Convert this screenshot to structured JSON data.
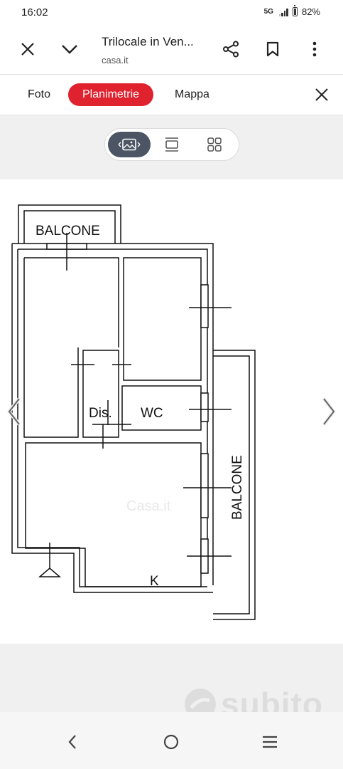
{
  "status_bar": {
    "time": "16:02",
    "network": "5G",
    "battery": "82%"
  },
  "browser": {
    "title": "Trilocale in Ven...",
    "url": "casa.it"
  },
  "tabs": [
    {
      "label": "Foto",
      "active": false
    },
    {
      "label": "Planimetrie",
      "active": true
    },
    {
      "label": "Mappa",
      "active": false
    }
  ],
  "viewer": {
    "modes": [
      "image-view",
      "list-view",
      "grid-view"
    ],
    "active_mode": "image-view"
  },
  "floor_plan": {
    "labels": {
      "balcony_top": "BALCONE",
      "balcony_right": "BALCONE",
      "hall": "Dis.",
      "bathroom": "WC",
      "kitchen": "K"
    },
    "overlay_text": "Casa.it"
  },
  "watermark": {
    "text": "subito"
  },
  "colors": {
    "accent": "#e0212e",
    "viewer_bg": "#f0f0f0",
    "segment_active": "#4b5563"
  }
}
